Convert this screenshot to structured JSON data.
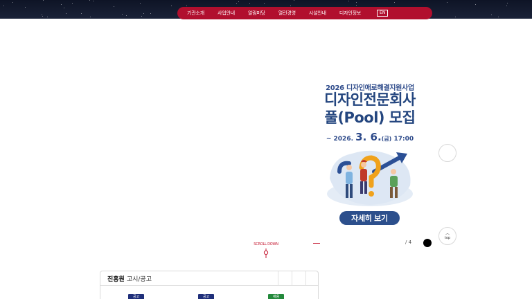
{
  "nav": {
    "items": [
      "기관소개",
      "사업안내",
      "알림마당",
      "열린경영",
      "시설안내",
      "디자인정보"
    ],
    "lang": "EN"
  },
  "banner": {
    "subtitle": "2026 디자인애로해결지원사업",
    "title_line1": "디자인전문회사",
    "title_line2": "풀(Pool) 모집",
    "date_prefix": "~ 2026.",
    "date_big": "3. 6.",
    "date_day": "(금)",
    "date_time": "17:00",
    "button": "자세히 보기",
    "pager": "/ 4"
  },
  "scroll": {
    "label": "SCROLL DOWN"
  },
  "top_button": {
    "label": "top"
  },
  "notice": {
    "org": "진흥원",
    "category": "고시/공고",
    "badges": [
      {
        "label": "공고",
        "color": "blue"
      },
      {
        "label": "공고",
        "color": "blue"
      },
      {
        "label": "채용",
        "color": "green"
      }
    ]
  },
  "colors": {
    "nav_red": "#b10f2e",
    "banner_blue": "#2c4f8c",
    "accent_red": "#c4162f"
  }
}
